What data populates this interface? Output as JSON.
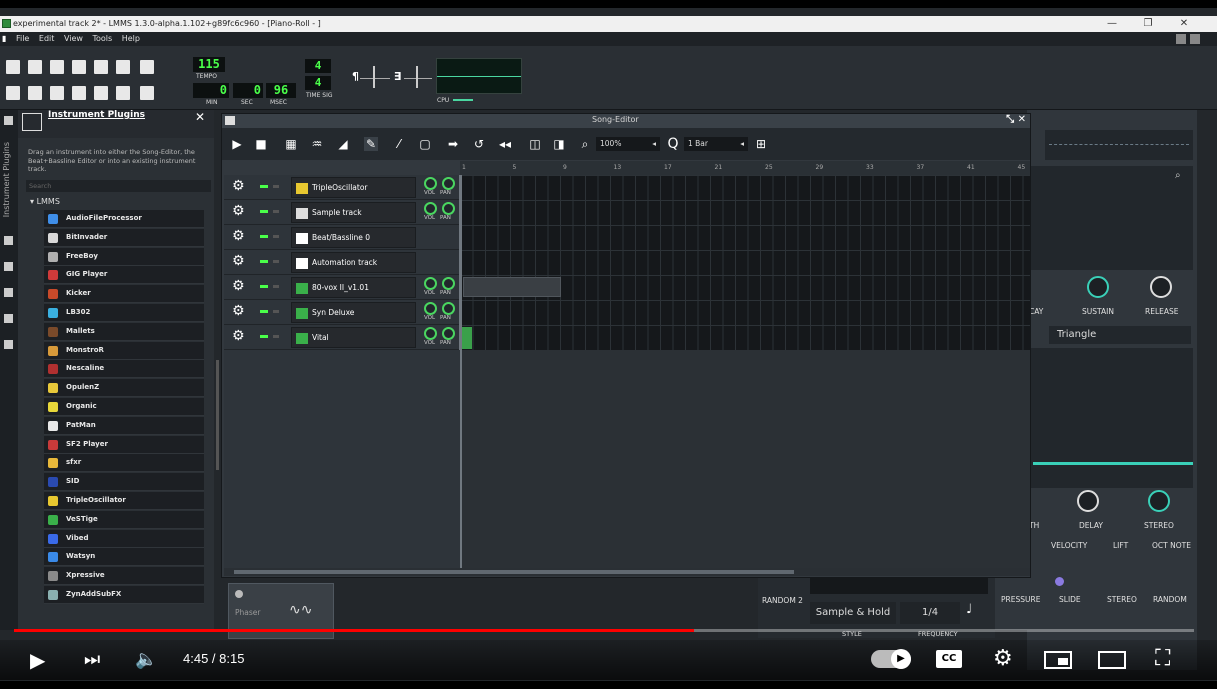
{
  "window": {
    "title": "experimental track 2* - LMMS 1.3.0-alpha.1.102+g89fc6c960 - [Piano-Roll - ]"
  },
  "menu": [
    "File",
    "Edit",
    "View",
    "Tools",
    "Help"
  ],
  "transport": {
    "tempo": "115",
    "tempo_label": "TEMPO",
    "min_value": "0",
    "sec_value": "0",
    "msec_value": "96",
    "min_label": "MIN",
    "sec_label": "SEC",
    "msec_label": "MSEC",
    "timesig_num": "4",
    "timesig_den": "4",
    "timesig_label": "TIME SIG",
    "cpu_label": "CPU"
  },
  "side_tab": {
    "label": "Instrument Plugins"
  },
  "plugins_panel": {
    "title": "Instrument Plugins",
    "close": "✕",
    "description": "Drag an instrument into either the Song-Editor, the Beat+Bassline Editor or into an existing instrument track.",
    "search_placeholder": "Search",
    "root": "LMMS",
    "items": [
      {
        "label": "AudioFileProcessor",
        "color": "#3f8ee8"
      },
      {
        "label": "BitInvader",
        "color": "#d8d8d8"
      },
      {
        "label": "FreeBoy",
        "color": "#b0b0b0"
      },
      {
        "label": "GIG Player",
        "color": "#d03a3a"
      },
      {
        "label": "Kicker",
        "color": "#c84a2a"
      },
      {
        "label": "LB302",
        "color": "#3ab0e0"
      },
      {
        "label": "Mallets",
        "color": "#7a4a2a"
      },
      {
        "label": "MonstroR",
        "color": "#d89a3a"
      },
      {
        "label": "Nescaline",
        "color": "#b03030"
      },
      {
        "label": "OpulenZ",
        "color": "#e8c83a"
      },
      {
        "label": "Organic",
        "color": "#e8d83a"
      },
      {
        "label": "PatMan",
        "color": "#e8e8e8"
      },
      {
        "label": "SF2 Player",
        "color": "#c83a3a"
      },
      {
        "label": "sfxr",
        "color": "#e8b83a"
      },
      {
        "label": "SID",
        "color": "#2a4ab0"
      },
      {
        "label": "TripleOscillator",
        "color": "#e8c830"
      },
      {
        "label": "VeSTige",
        "color": "#3ab04a"
      },
      {
        "label": "Vibed",
        "color": "#3a6ae8"
      },
      {
        "label": "Watsyn",
        "color": "#3a8ae8"
      },
      {
        "label": "Xpressive",
        "color": "#8a8a8a"
      },
      {
        "label": "ZynAddSubFX",
        "color": "#8ab0b0"
      }
    ]
  },
  "song_editor": {
    "title": "Song-Editor",
    "zoom": "100%",
    "quantize": "1 Bar",
    "ruler": [
      "1",
      "5",
      "9",
      "13",
      "17",
      "21",
      "25",
      "29",
      "33",
      "37",
      "41",
      "45"
    ],
    "tracks": [
      {
        "name": "TripleOscillator",
        "icon_color": "#e8c830"
      },
      {
        "name": "Sample track",
        "icon_color": "#dddddd"
      },
      {
        "name": "Beat/Bassline 0",
        "icon_color": "#ffffff"
      },
      {
        "name": "Automation track",
        "icon_color": "#ffffff"
      },
      {
        "name": "80-vox II_v1.01",
        "icon_color": "#3ab04a"
      },
      {
        "name": "Syn Deluxe",
        "icon_color": "#3ab04a"
      },
      {
        "name": "Vital",
        "icon_color": "#3ab04a"
      }
    ],
    "vol_label": "VOL",
    "pan_label": "PAN"
  },
  "background_panel": {
    "sustain": "SUSTAIN",
    "release": "RELEASE",
    "decay_partial": "CAY",
    "waveform": "Triangle",
    "delay": "DELAY",
    "stereo": "STEREO",
    "depth_partial": "TH",
    "velocity": "VELOCITY",
    "lift": "LIFT",
    "oct_note": "OCT NOTE",
    "pressure": "PRESSURE",
    "slide": "SLIDE",
    "stereo2": "STEREO",
    "random": "RANDOM",
    "random2": "RANDOM 2",
    "sample_hold": "Sample & Hold",
    "fraction": "1/4",
    "style": "STYLE",
    "frequency": "FREQUENCY",
    "phaser": "Phaser"
  },
  "player": {
    "time": "4:45 / 8:15",
    "progress": 0.576
  }
}
